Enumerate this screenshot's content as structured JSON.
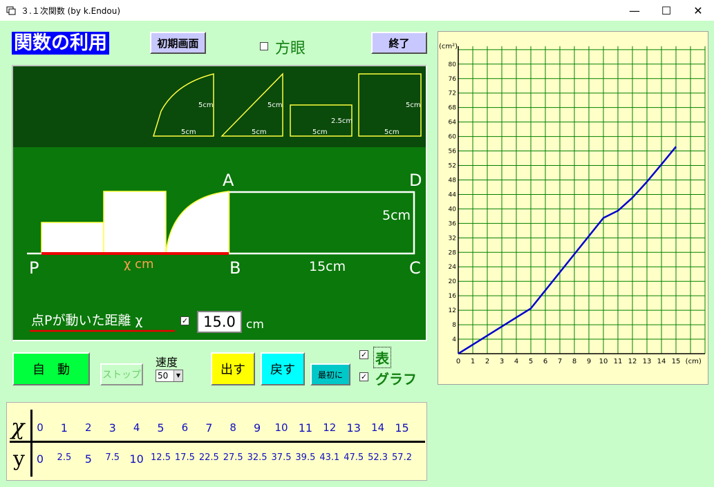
{
  "window": {
    "title": "３.１次関数 (by k.Endou)",
    "minimize": "—",
    "maximize": "☐",
    "close": "✕"
  },
  "header": {
    "page_title": "関数の利用",
    "reset_label": "初期画面",
    "grid_label": "方眼",
    "exit_label": "終了"
  },
  "shapes": [
    {
      "type": "quarter",
      "width_label": "5cm",
      "height_label": "5cm"
    },
    {
      "type": "triangle",
      "width_label": "5cm",
      "height_label": "5cm"
    },
    {
      "type": "rectangle",
      "width_label": "5cm",
      "height_label": "2.5cm"
    },
    {
      "type": "square",
      "width_label": "5cm",
      "height_label": "5cm"
    }
  ],
  "scene": {
    "point_p": "P",
    "point_a": "A",
    "point_b": "B",
    "point_c": "C",
    "point_d": "D",
    "x_label": "χ cm",
    "length_bc": "15cm",
    "height_cd": "5cm",
    "distance_label": "点Pが動いた距離 χ",
    "distance_value": "15.0",
    "distance_unit": "cm",
    "distance_checked": true
  },
  "controls": {
    "auto_label": "自　動",
    "stop_label": "ストップ",
    "speed_label": "速度",
    "speed_value": "50",
    "show_label": "出す",
    "back_label": "戻す",
    "first_label": "最初に",
    "table_check": "表",
    "graph_check": "グラフ",
    "table_checked": true,
    "graph_checked": true
  },
  "table": {
    "x_header": "χ",
    "y_header": "y",
    "x_values": [
      "0",
      "1",
      "2",
      "3",
      "4",
      "5",
      "6",
      "7",
      "8",
      "9",
      "10",
      "11",
      "12",
      "13",
      "14",
      "15"
    ],
    "y_values": [
      "0",
      "2.5",
      "5",
      "7.5",
      "10",
      "12.5",
      "17.5",
      "22.5",
      "27.5",
      "32.5",
      "37.5",
      "39.5",
      "43.1",
      "47.5",
      "52.3",
      "57.2"
    ]
  },
  "chart_data": {
    "type": "line",
    "title": "",
    "xlabel": "(cm)",
    "ylabel": "(cm²)",
    "xlim": [
      0,
      17
    ],
    "ylim": [
      0,
      84
    ],
    "x_ticks": [
      0,
      1,
      2,
      3,
      4,
      5,
      6,
      7,
      8,
      9,
      10,
      11,
      12,
      13,
      14,
      15
    ],
    "y_ticks": [
      4,
      8,
      12,
      16,
      20,
      24,
      28,
      32,
      36,
      40,
      44,
      48,
      52,
      56,
      60,
      64,
      68,
      72,
      76,
      80
    ],
    "grid": true,
    "line_color": "#0000cc",
    "series": [
      {
        "x": [
          0,
          1,
          2,
          3,
          4,
          5,
          6,
          7,
          8,
          9,
          10,
          11,
          12,
          13,
          14,
          15
        ],
        "values": [
          0,
          2.5,
          5,
          7.5,
          10,
          12.5,
          17.5,
          22.5,
          27.5,
          32.5,
          37.5,
          39.5,
          43.1,
          47.5,
          52.3,
          57.2
        ]
      }
    ]
  }
}
